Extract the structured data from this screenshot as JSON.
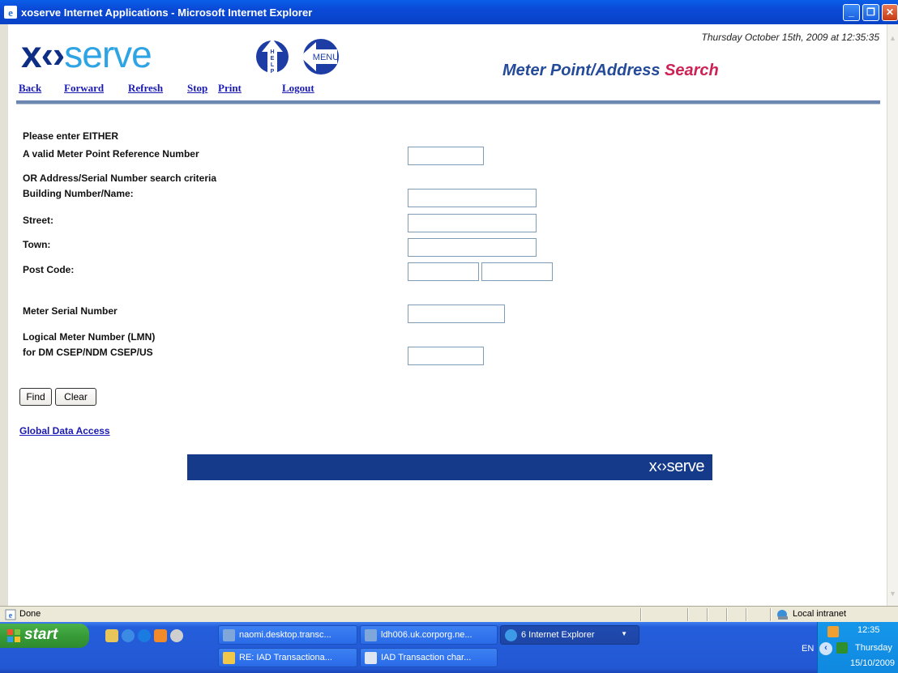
{
  "window": {
    "title": "xoserve Internet Applications - Microsoft Internet Explorer",
    "minimize": "_",
    "restore": "❐",
    "close": "✕"
  },
  "header": {
    "logo_xo": "x‹›",
    "logo_rest": "serve",
    "help_icon": "help-icon",
    "menu_icon": "menu-icon",
    "help_text": "HELP",
    "menu_text": "MENU",
    "datetime": "Thursday October 15th, 2009 at 12:35:35",
    "title_main": "Meter Point/Address ",
    "title_accent": "Search",
    "nav": [
      "Back",
      "Forward",
      "Refresh",
      "Stop",
      "Print",
      "Logout"
    ]
  },
  "form": {
    "intro": "Please enter EITHER",
    "mprn_label": "A valid Meter Point Reference Number",
    "or_label": "OR Address/Serial Number search criteria",
    "building_label": "Building Number/Name:",
    "street_label": "Street:",
    "town_label": "Town:",
    "postcode_label": "Post Code:",
    "serial_label": "Meter Serial Number",
    "lmn_label1": "Logical Meter Number (LMN)",
    "lmn_label2": "for DM CSEP/NDM CSEP/US",
    "values": {
      "mprn": "",
      "building": "",
      "street": "",
      "town": "",
      "postcode1": "",
      "postcode2": "",
      "serial": "",
      "lmn": ""
    },
    "find_label": "Find",
    "clear_label": "Clear",
    "global_link": "Global Data Access",
    "footer_logo": "x‹›serve"
  },
  "statusbar": {
    "status": "Done",
    "zone": "Local intranet"
  },
  "taskbar": {
    "start": "start",
    "tasks_top": [
      {
        "label": "naomi.desktop.transc...",
        "icon": "remote-desktop-icon"
      },
      {
        "label": "ldh006.uk.corporg.ne...",
        "icon": "remote-desktop-icon"
      },
      {
        "label": "6 Internet Explorer",
        "icon": "ie-icon"
      }
    ],
    "tasks_bottom": [
      {
        "label": "RE: IAD Transactiona...",
        "icon": "mail-icon"
      },
      {
        "label": "IAD Transaction char...",
        "icon": "word-icon"
      }
    ],
    "tray": {
      "lang": "EN",
      "time": "12:35",
      "day": "Thursday",
      "date": "15/10/2009"
    }
  }
}
